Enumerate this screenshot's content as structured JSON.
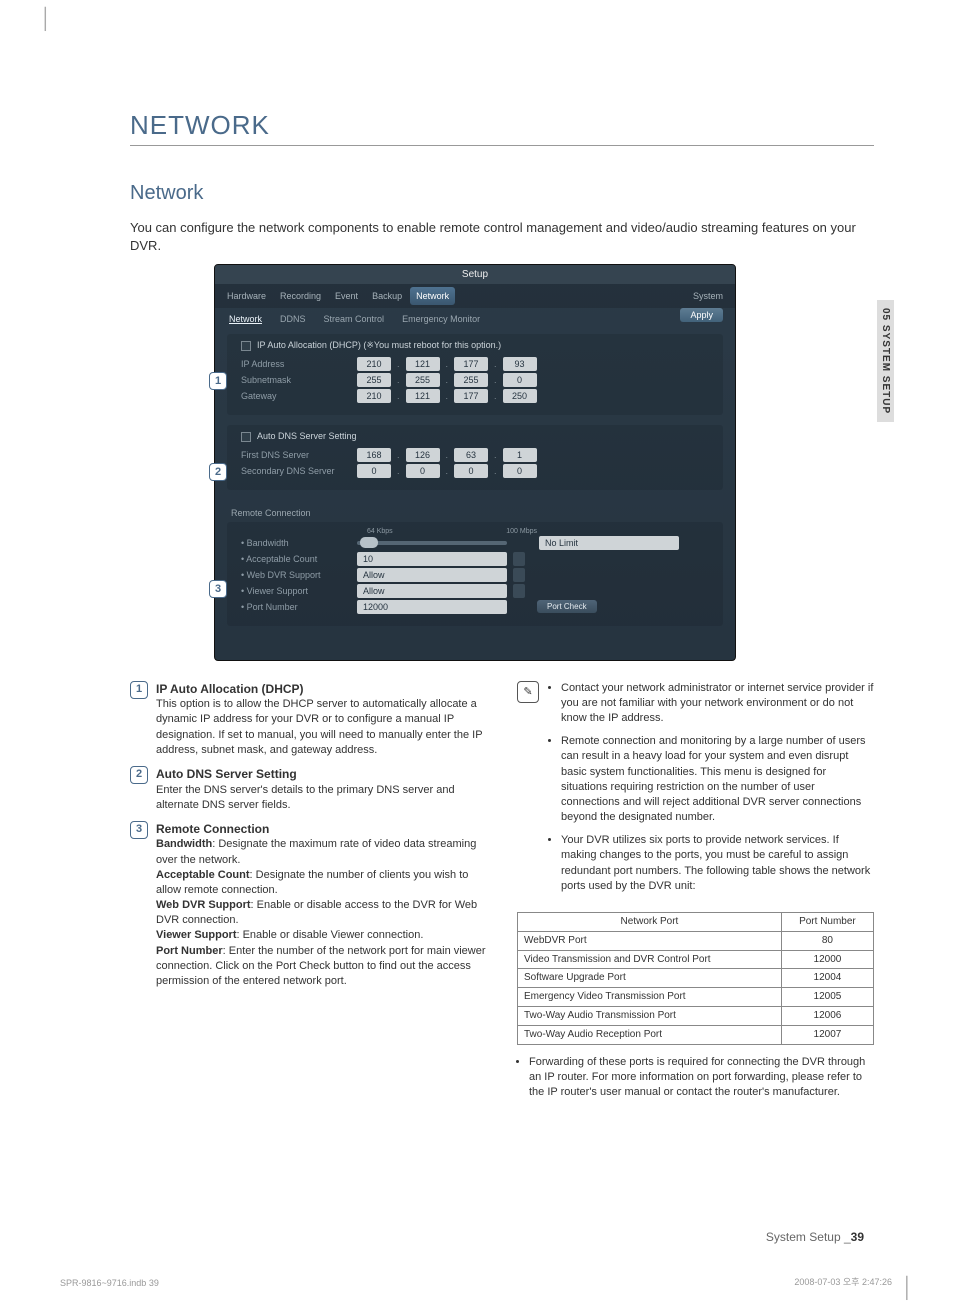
{
  "header": {
    "main_title": "NETWORK",
    "section_title": "Network"
  },
  "intro": "You can configure the network components to enable remote control management and video/audio streaming features on your DVR.",
  "side_tab": "05 SYSTEM SETUP",
  "footer": {
    "label": "System Setup _",
    "page": "39"
  },
  "print": {
    "file": "SPR-9816~9716.indb   39",
    "stamp": "2008-07-03   오후 2:47:26"
  },
  "shot": {
    "title": "Setup",
    "tabs": [
      "Hardware",
      "Recording",
      "Event",
      "Backup",
      "Network",
      "System"
    ],
    "subtabs": [
      "Network",
      "DDNS",
      "Stream Control",
      "Emergency Monitor"
    ],
    "apply": "Apply",
    "g1_header": "IP Auto Allocation (DHCP)   (※You must reboot for this option.)",
    "labels": {
      "ip": "IP Address",
      "sn": "Subnetmask",
      "gw": "Gateway",
      "g2": "Auto DNS Server Setting",
      "dns1": "First DNS Server",
      "dns2": "Secondary DNS Server",
      "g3": "Remote Connection",
      "bw": "Bandwidth",
      "ac": "Acceptable Count",
      "web": "Web DVR Support",
      "view": "Viewer Support",
      "port": "Port Number",
      "portcheck": "Port Check",
      "nolimit": "No Limit",
      "bw_min": "64 Kbps",
      "bw_max": "100 Mbps"
    },
    "ip": {
      "a": [
        "210",
        "121",
        "177",
        "93"
      ],
      "s": [
        "255",
        "255",
        "255",
        "0"
      ],
      "g": [
        "210",
        "121",
        "177",
        "250"
      ]
    },
    "dns": {
      "p": [
        "168",
        "126",
        "63",
        "1"
      ],
      "s": [
        "0",
        "0",
        "0",
        "0"
      ]
    },
    "remote": {
      "ac": "10",
      "web": "Allow",
      "view": "Allow",
      "port": "12000"
    }
  },
  "legend": {
    "i1": {
      "title": "IP Auto Allocation (DHCP)",
      "body": "This option is to allow the DHCP server to automatically allocate a dynamic IP address for your DVR or to configure a manual IP designation. If set to manual, you will need to manually enter the IP address, subnet mask, and gateway address."
    },
    "i2": {
      "title": "Auto DNS Server Setting",
      "body": "Enter the DNS server's details to the primary DNS server and alternate DNS server fields."
    },
    "i3": {
      "title": "Remote Connection",
      "defs": {
        "bw_t": "Bandwidth",
        "bw": ": Designate the maximum rate of video data streaming over the network.",
        "ac_t": "Acceptable Count",
        "ac": ": Designate the number of clients you wish to allow remote connection.",
        "web_t": "Web DVR Support",
        "web": ": Enable or disable access to the DVR for Web DVR connection.",
        "view_t": "Viewer Support",
        "view": ": Enable or disable Viewer connection.",
        "port_t": "Port Number",
        "port": ": Enter the number of the network port for main viewer connection. Click on the Port Check button to find out the access permission of the entered network port."
      }
    }
  },
  "notes": {
    "n1": "Contact your network administrator or internet service provider if you are not familiar with your network environment or do not know the IP address.",
    "n2": "Remote connection and monitoring by a large number of users can result in a heavy load for your system and even disrupt basic system functionalities. This menu is designed for situations requiring restriction on the number of user connections and will reject additional DVR server connections beyond the designated number.",
    "n3": "Your DVR utilizes six ports to provide network services. If making changes to the ports, you must be careful to assign redundant port numbers. The following table shows the network ports used by the DVR unit:",
    "n4": "Forwarding of these ports is required for connecting the DVR through an IP router. For more information on port forwarding, please refer to the IP router's user manual or contact the router's manufacturer."
  },
  "ports": {
    "h1": "Network Port",
    "h2": "Port Number",
    "rows": [
      [
        "WebDVR Port",
        "80"
      ],
      [
        "Video Transmission and DVR Control Port",
        "12000"
      ],
      [
        "Software Upgrade Port",
        "12004"
      ],
      [
        "Emergency Video Transmission Port",
        "12005"
      ],
      [
        "Two-Way Audio Transmission Port",
        "12006"
      ],
      [
        "Two-Way Audio Reception Port",
        "12007"
      ]
    ]
  }
}
